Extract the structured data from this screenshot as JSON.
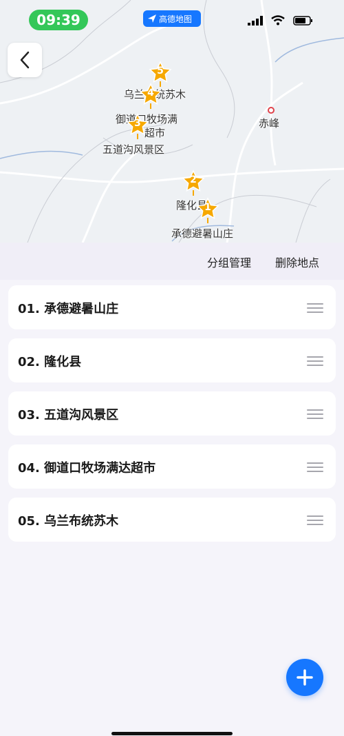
{
  "status_bar": {
    "time": "09:39",
    "app_badge": "高德地图"
  },
  "map": {
    "labels": {
      "chifeng": "赤峰",
      "wulanbu": "乌兰布统苏木",
      "yudaokou_line1": "御道口牧场满",
      "yudaokou_line2": "超市",
      "wudaogou": "五道沟风景区",
      "longhua": "隆化县",
      "chengde": "承德避暑山庄"
    },
    "pins": [
      "1",
      "2",
      "3",
      "4",
      "5"
    ]
  },
  "toolbar": {
    "group_manage": "分组管理",
    "delete_places": "删除地点"
  },
  "places": [
    "01. 承德避暑山庄",
    "02. 隆化县",
    "03. 五道沟风景区",
    "04. 御道口牧场满达超市",
    "05. 乌兰布统苏木"
  ],
  "colors": {
    "accent": "#1677ff",
    "pin": "#f6a800",
    "status_time": "#34c759"
  }
}
